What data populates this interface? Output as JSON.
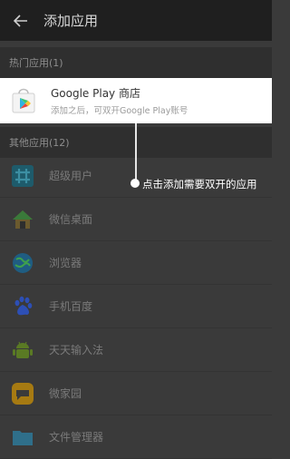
{
  "app_bar": {
    "title": "添加应用",
    "back_icon": "arrow-left-icon"
  },
  "hot_section": {
    "header": "热门应用(1)"
  },
  "featured_app": {
    "name": "Google Play 商店",
    "subtitle": "添加之后，可双开Google Play账号",
    "icon": "google-play-icon"
  },
  "other_section": {
    "header": "其他应用(12)"
  },
  "apps": [
    {
      "label": "超级用户",
      "icon": "superuser-icon"
    },
    {
      "label": "微信桌面",
      "icon": "home-launcher-icon"
    },
    {
      "label": "浏览器",
      "icon": "browser-globe-icon"
    },
    {
      "label": "手机百度",
      "icon": "baidu-paw-icon"
    },
    {
      "label": "天天输入法",
      "icon": "android-robot-icon"
    },
    {
      "label": "微家园",
      "icon": "chat-bubble-icon"
    },
    {
      "label": "文件管理器",
      "icon": "folder-icon"
    }
  ],
  "tooltip": {
    "text": "点击添加需要双开的应用"
  },
  "colors": {
    "accent": "#ffffff",
    "overlay": "#3a3a3a"
  }
}
